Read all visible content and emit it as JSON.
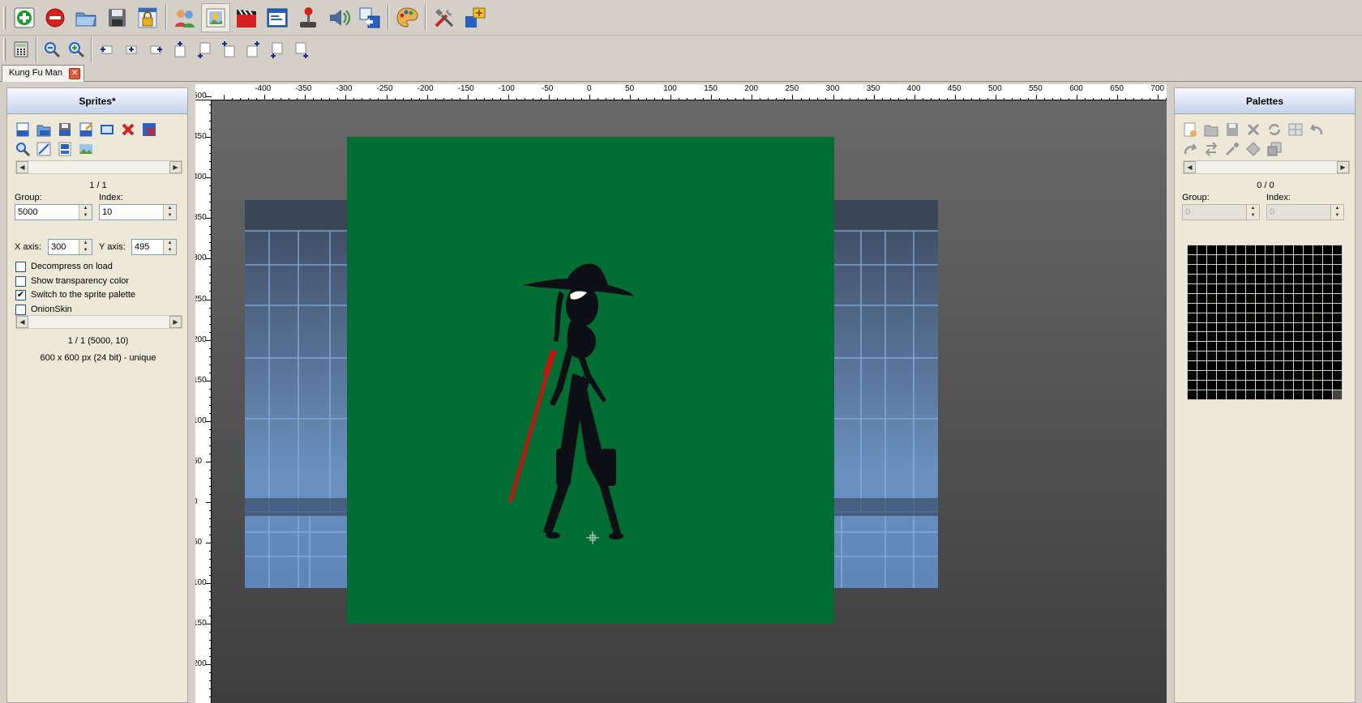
{
  "tab": {
    "label": "Kung Fu Man"
  },
  "sprites": {
    "title": "Sprites*",
    "counter": "1 / 1",
    "group_label": "Group:",
    "group_value": "5000",
    "index_label": "Index:",
    "index_value": "10",
    "xaxis_label": "X axis:",
    "xaxis_value": "300",
    "yaxis_label": "Y axis:",
    "yaxis_value": "495",
    "options": [
      {
        "label": "Decompress on load",
        "checked": false
      },
      {
        "label": "Show transparency color",
        "checked": false
      },
      {
        "label": "Switch to the sprite palette",
        "checked": true
      },
      {
        "label": "OnionSkin",
        "checked": false
      }
    ],
    "info1": "1 / 1 (5000, 10)",
    "info2": "600 x 600 px (24 bit) - unique"
  },
  "palettes": {
    "title": "Palettes",
    "counter": "0 / 0",
    "group_label": "Group:",
    "group_value": "0",
    "index_label": "Index:",
    "index_value": "0"
  },
  "ruler": {
    "top_labels": [
      "-400",
      "-350",
      "-300",
      "-250",
      "-200",
      "-150",
      "-100",
      "-50",
      "0",
      "50",
      "100",
      "150",
      "200",
      "250",
      "300",
      "350",
      "400",
      "450",
      "500",
      "550",
      "600",
      "650",
      "700"
    ],
    "left_labels": [
      "500",
      "450",
      "400",
      "350",
      "300",
      "250",
      "200",
      "150",
      "100",
      "50",
      "0",
      "50",
      "100",
      "150",
      "200"
    ]
  },
  "colors": {
    "sprite_bg": "#006e33",
    "panel_bg": "#ece9d8",
    "toolbar_bg": "#d4d0c8",
    "accent": "#c5d3ee"
  }
}
